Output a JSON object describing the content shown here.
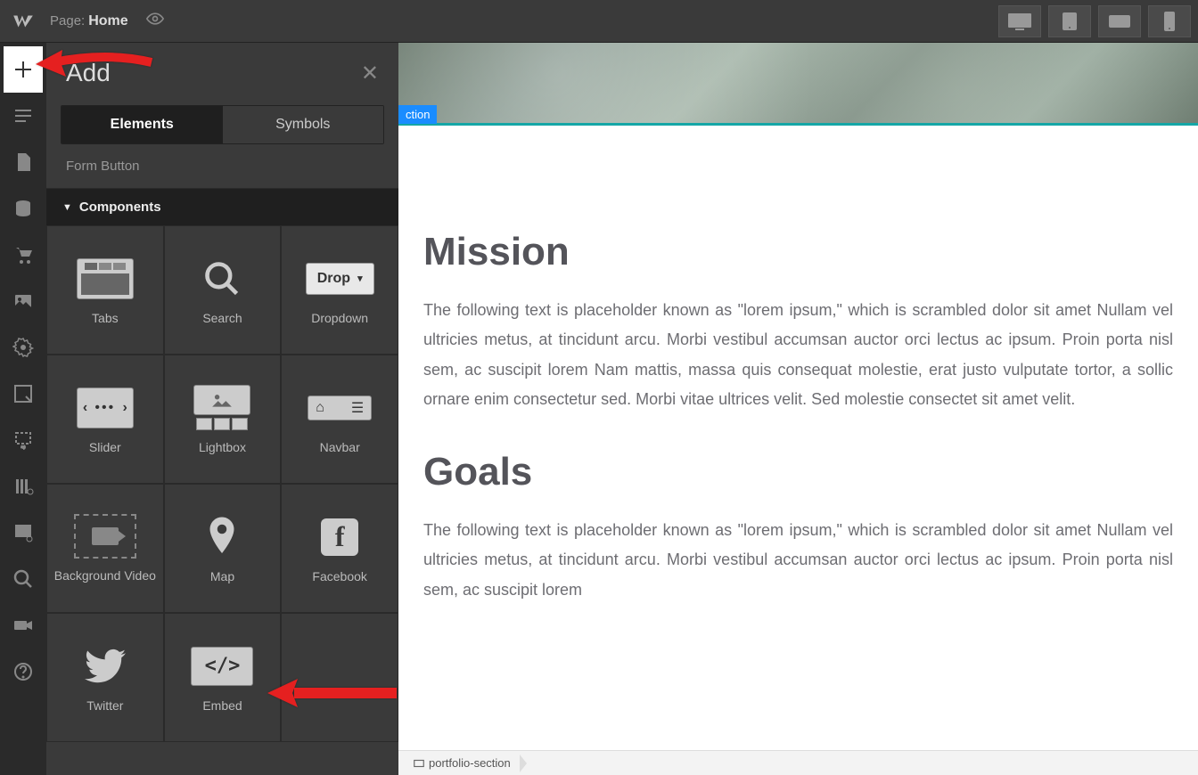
{
  "topbar": {
    "page_prefix": "Page:",
    "page_name": "Home"
  },
  "panel": {
    "title": "Add",
    "tabs": {
      "elements": "Elements",
      "symbols": "Symbols"
    },
    "form_button": "Form Button",
    "section_title": "Components",
    "components": [
      {
        "label": "Tabs"
      },
      {
        "label": "Search"
      },
      {
        "label": "Dropdown",
        "btn": "Drop"
      },
      {
        "label": "Slider"
      },
      {
        "label": "Lightbox"
      },
      {
        "label": "Navbar"
      },
      {
        "label": "Background Video"
      },
      {
        "label": "Map"
      },
      {
        "label": "Facebook"
      },
      {
        "label": "Twitter"
      },
      {
        "label": "Embed"
      }
    ]
  },
  "canvas": {
    "chip": "ction",
    "heading1": "Mission",
    "para1": "The following text is placeholder known as \"lorem ipsum,\" which is scrambled dolor sit amet Nullam vel ultricies metus, at tincidunt arcu. Morbi vestibul accumsan auctor orci lectus ac ipsum. Proin porta nisl sem, ac suscipit lorem Nam mattis, massa quis consequat molestie, erat justo vulputate tortor, a sollic ornare enim consectetur sed. Morbi vitae ultrices velit. Sed molestie consectet sit amet velit.",
    "heading2": "Goals",
    "para2": "The following text is placeholder known as \"lorem ipsum,\" which is scrambled dolor sit amet Nullam vel ultricies metus, at tincidunt arcu. Morbi vestibul accumsan auctor orci lectus ac ipsum. Proin porta nisl sem, ac suscipit lorem"
  },
  "breadcrumb": {
    "item": "portfolio-section"
  }
}
